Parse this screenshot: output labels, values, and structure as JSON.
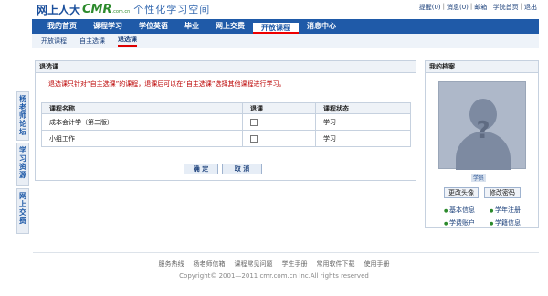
{
  "header": {
    "logo_cn": "网上人大",
    "logo_cmr": "CMR",
    "logo_sub": ".com.cn",
    "slogan": "个性化学习空间",
    "links": [
      "提醒(0)",
      "消息(0)",
      "邮箱",
      "学院首页",
      "退出"
    ]
  },
  "nav": {
    "items": [
      "我的首页",
      "课程学习",
      "学位英语",
      "毕业",
      "网上交费",
      "开放课程",
      "消息中心"
    ]
  },
  "subnav": {
    "items": [
      "开放课程",
      "自主选课",
      "退选课"
    ]
  },
  "sidetabs": [
    "杨老师论坛",
    "学习资源",
    "网上交费"
  ],
  "panel": {
    "title": "退选课",
    "notice": "退选课只针对“自主选课”的课程，退课后可以在“自主选课”选择其他课程进行学习。",
    "columns": [
      "课程名称",
      "退课",
      "课程状态"
    ],
    "rows": [
      {
        "name": "成本会计学（第二版）",
        "status": "学习"
      },
      {
        "name": "小组工作",
        "status": "学习"
      }
    ],
    "confirm": "确 定",
    "cancel": "取 消"
  },
  "profile": {
    "title": "我的档案",
    "username": "学员",
    "change_avatar": "更改头像",
    "change_password": "修改密码",
    "links": [
      "基本信息",
      "学年注册",
      "学费账户",
      "学籍信息"
    ]
  },
  "footer": {
    "links": [
      "服务热线",
      "杨老师信箱",
      "课程常见问题",
      "学生手册",
      "常用软件下载",
      "使用手册"
    ],
    "copyright": "Copyright© 2001—2011 cmr.com.cn Inc.All rights reserved"
  }
}
